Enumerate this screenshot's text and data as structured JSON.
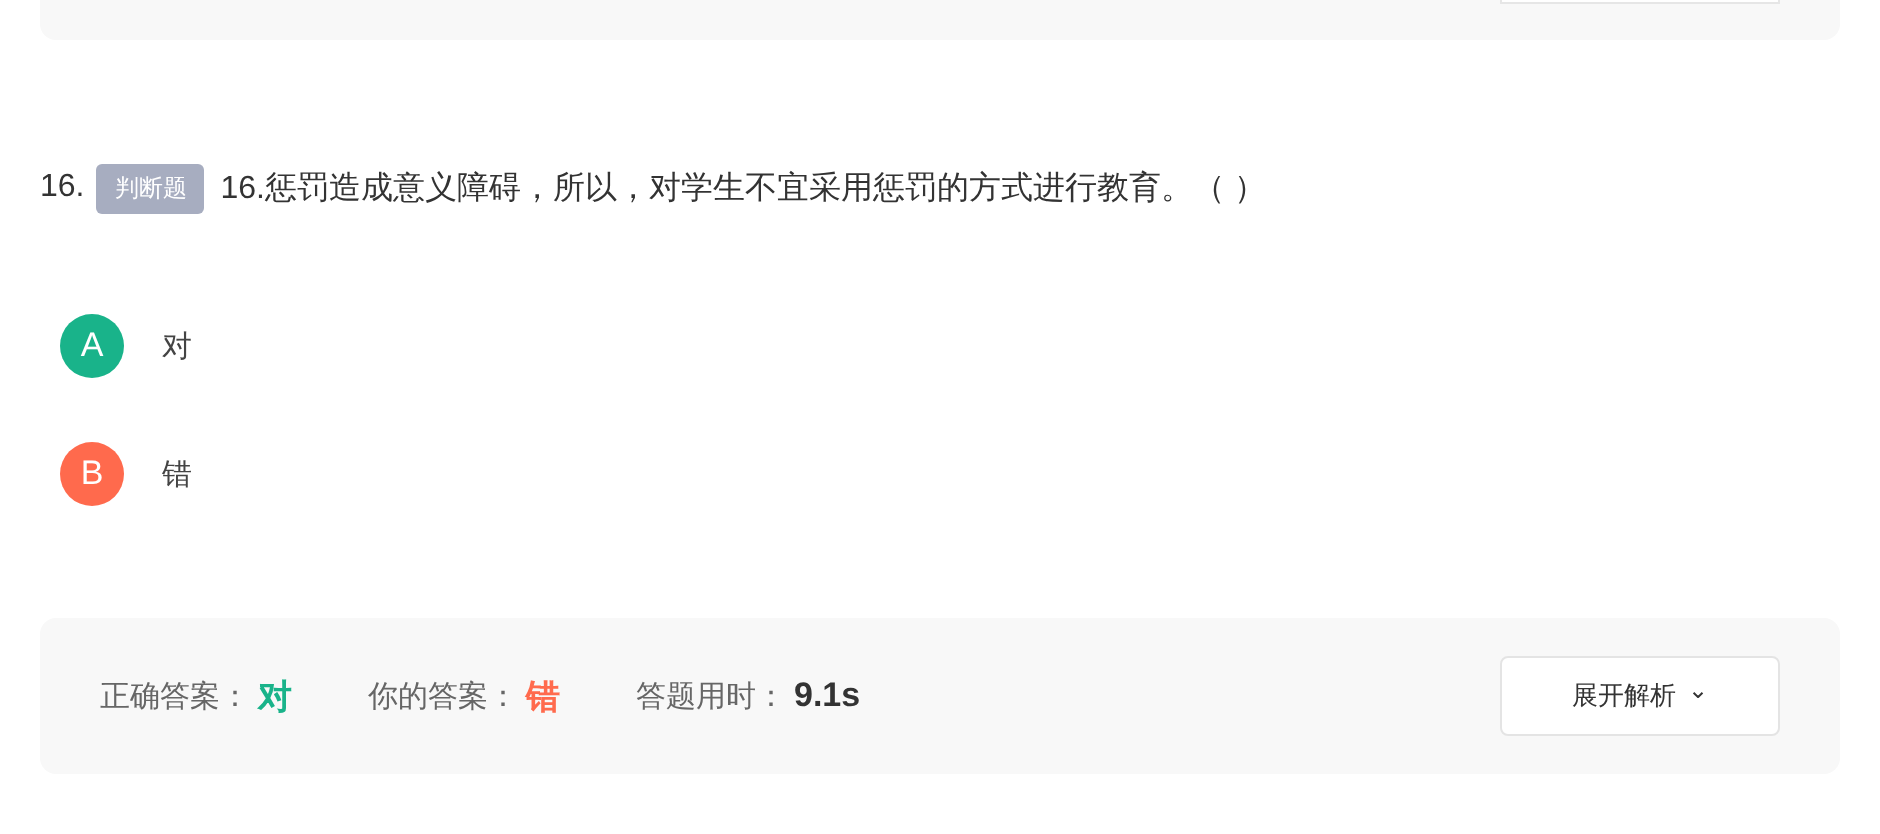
{
  "question": {
    "number": "16.",
    "tag": "判断题",
    "text": "16.惩罚造成意义障碍，所以，对学生不宜采用惩罚的方式进行教育。（ ）"
  },
  "options": [
    {
      "letter": "A",
      "text": "对",
      "color": "#19b38a"
    },
    {
      "letter": "B",
      "text": "错",
      "color": "#ff6a4d"
    }
  ],
  "result": {
    "items": [
      {
        "label": "正确答案：",
        "value": "对",
        "kind": "correct"
      },
      {
        "label": "你的答案：",
        "value": "错",
        "kind": "wrong"
      },
      {
        "label": "答题用时：",
        "value": "9.1s",
        "kind": "time"
      }
    ],
    "button": {
      "label": "展开解析",
      "icon": "⌄"
    }
  }
}
